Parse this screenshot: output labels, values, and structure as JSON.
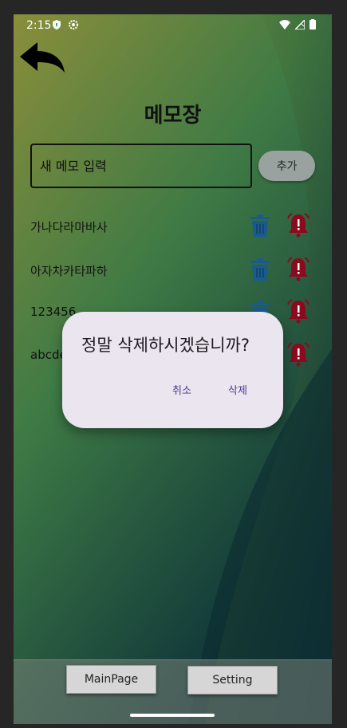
{
  "status": {
    "time": "2:15"
  },
  "page": {
    "title": "메모장"
  },
  "input": {
    "placeholder": "새 메모 입력",
    "add_label": "추가"
  },
  "memos": [
    {
      "text": "가나다라마바사"
    },
    {
      "text": "아자차카타파하"
    },
    {
      "text": "123456"
    },
    {
      "text": "abcde"
    }
  ],
  "dialog": {
    "message": "정말 삭제하시겠습니까?",
    "cancel_label": "취소",
    "delete_label": "삭제"
  },
  "nav": {
    "main_label": "MainPage",
    "setting_label": "Setting"
  },
  "colors": {
    "trash": "#1a5a8c",
    "alarm": "#8b0a1e",
    "dialog_bg": "#ebe5f0",
    "accent": "#4a3d8f"
  },
  "icons": {
    "back": "back-arrow-icon",
    "trash": "trash-icon",
    "alarm": "alarm-icon"
  }
}
